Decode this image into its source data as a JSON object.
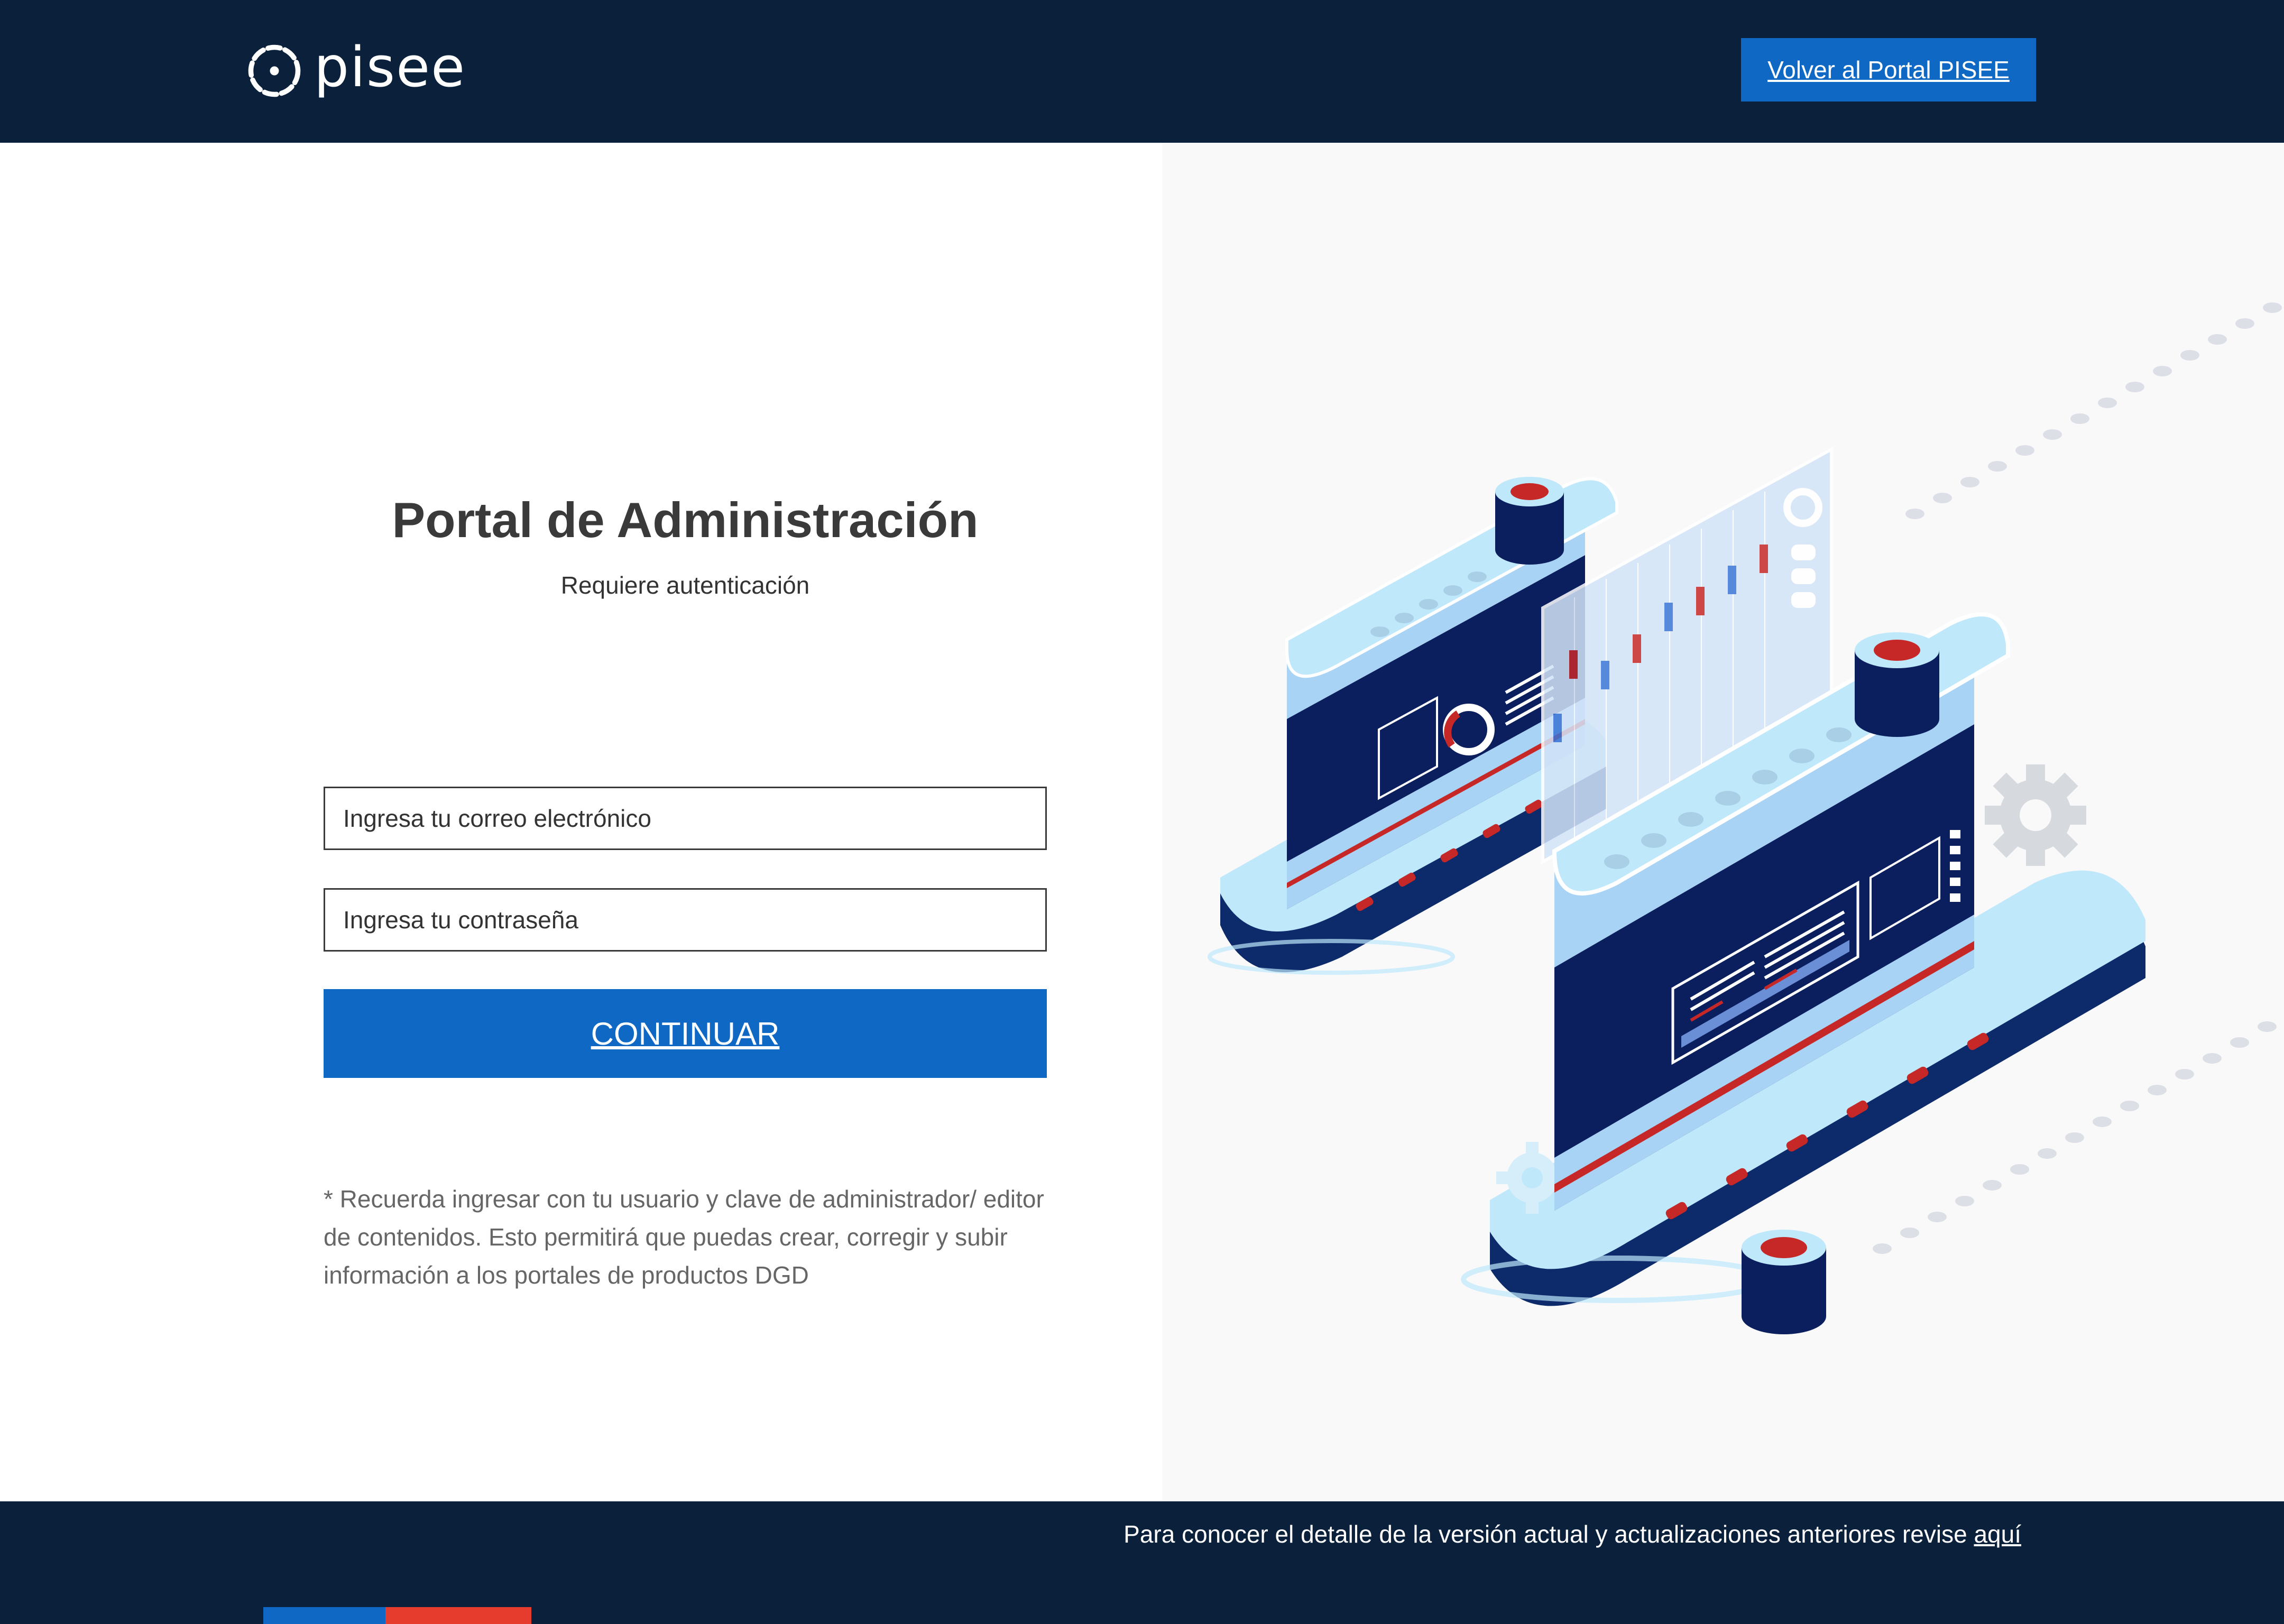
{
  "header": {
    "logo_text": "pisee",
    "back_button_label": "Volver al Portal PISEE"
  },
  "login": {
    "title": "Portal de Administración",
    "subtitle": "Requiere autenticación",
    "email_placeholder": "Ingresa tu correo electrónico",
    "password_placeholder": "Ingresa tu contraseña",
    "continue_label": "CONTINUAR",
    "note": "* Recuerda ingresar con tu usuario y clave de administrador/ editor de contenidos. Esto permitirá que puedas crear, corregir y subir información a los portales de productos DGD"
  },
  "footer": {
    "text": "Para conocer el detalle de la versión actual y actualizaciones anteriores revise ",
    "link_label": "aquí"
  },
  "colors": {
    "header_bg": "#0b213b",
    "primary": "#0f69c4",
    "accent_red": "#e63c2e",
    "illustration_bg": "#f9f9fa"
  },
  "icons": [
    "pisee-logo-icon",
    "server-illustration",
    "gear-icon"
  ]
}
